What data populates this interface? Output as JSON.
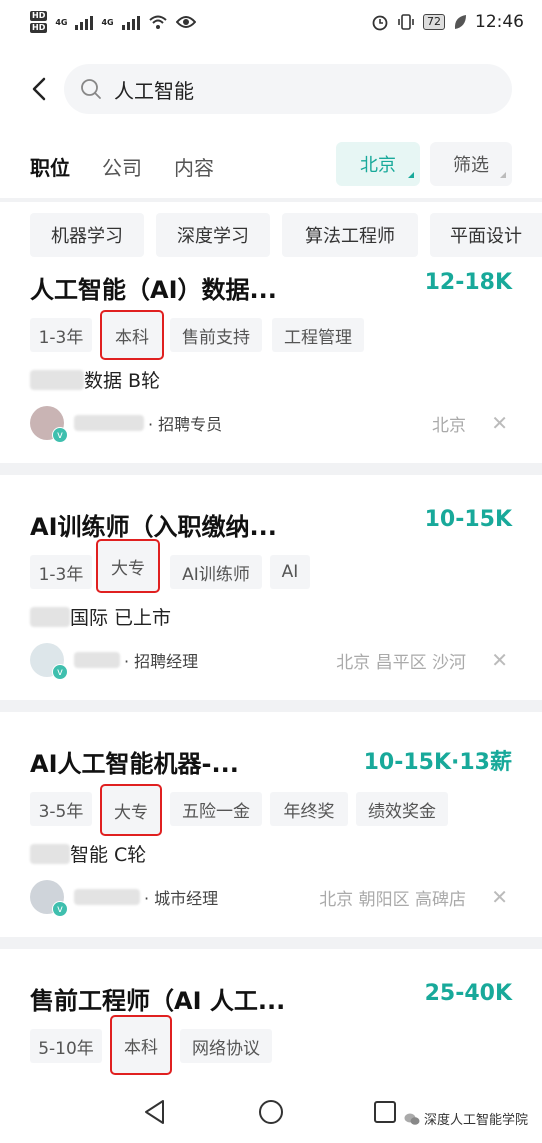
{
  "status_bar": {
    "hd1": "HD",
    "hd2": "HD",
    "net1": "4G",
    "net2": "4G",
    "battery": "72",
    "time": "12:46"
  },
  "search": {
    "value": "人工智能"
  },
  "tabs": [
    {
      "label": "职位",
      "active": true
    },
    {
      "label": "公司",
      "active": false
    },
    {
      "label": "内容",
      "active": false
    }
  ],
  "filters": {
    "city": "北京",
    "screen": "筛选"
  },
  "keywords": [
    "机器学习",
    "深度学习",
    "算法工程师",
    "平面设计"
  ],
  "jobs": [
    {
      "title": "人工智能（AI）数据...",
      "salary": "12-18K",
      "tags": [
        "1-3年",
        "本科",
        "售前支持",
        "工程管理"
      ],
      "highlight": 1,
      "company_suffix": "数据  B轮",
      "recruiter_title": "· 招聘专员",
      "location": "北京"
    },
    {
      "title": "AI训练师（入职缴纳...",
      "salary": "10-15K",
      "tags": [
        "1-3年",
        "大专",
        "AI训练师",
        "AI"
      ],
      "highlight": 1,
      "company_suffix": "国际  已上市",
      "recruiter_title": "· 招聘经理",
      "location": "北京  昌平区  沙河"
    },
    {
      "title": "AI人工智能机器-...",
      "salary": "10-15K·13薪",
      "tags": [
        "3-5年",
        "大专",
        "五险一金",
        "年终奖",
        "绩效奖金"
      ],
      "highlight": 1,
      "company_suffix": "智能  C轮",
      "recruiter_title": "· 城市经理",
      "location": "北京  朝阳区  高碑店"
    },
    {
      "title": "售前工程师（AI 人工...",
      "salary": "25-40K",
      "tags": [
        "5-10年",
        "本科",
        "网络协议"
      ],
      "highlight": 1
    }
  ],
  "nav": {
    "watermark": "深度人工智能学院"
  },
  "colors": {
    "accent": "#18a99a",
    "highlight_box": "#e02020"
  }
}
